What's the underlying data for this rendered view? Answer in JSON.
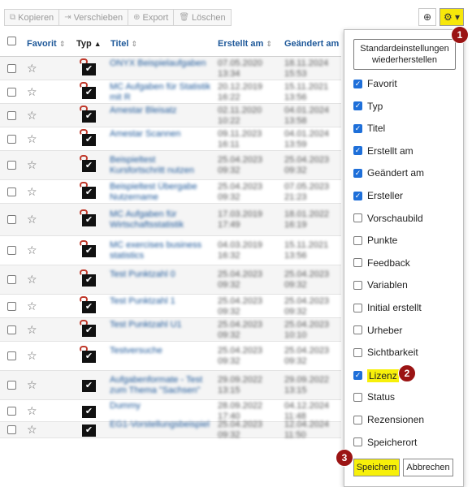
{
  "toolbar": {
    "copy_label": "Kopieren",
    "move_label": "Verschieben",
    "export_label": "Export",
    "delete_label": "Löschen"
  },
  "columns": {
    "favorit": "Favorit",
    "typ": "Typ",
    "titel": "Titel",
    "erstellt": "Erstellt am",
    "geaendert": "Geändert am"
  },
  "rows": [
    {
      "title": "ONYX Beispielaufgaben",
      "created": "07.05.2020\n13:34",
      "changed": "18.11.2024\n15:53",
      "clip": true
    },
    {
      "title": "MC Aufgaben für Statistik mit R",
      "created": "20.12.2019\n16:22",
      "changed": "15.11.2021\n13:56",
      "clip": true
    },
    {
      "title": "Amestar Bleisatz",
      "created": "02.11.2020\n10:22",
      "changed": "04.01.2024\n13:58",
      "clip": true
    },
    {
      "title": "Amestar Scannen",
      "created": "09.11.2023\n16:11",
      "changed": "04.01.2024\n13:59",
      "clip": true
    },
    {
      "title": "Beispieltest Kursfortschritt nutzen",
      "created": "25.04.2023\n09:32",
      "changed": "25.04.2023\n09:32",
      "clip": true
    },
    {
      "title": "Beispieltest Übergabe Nutzername",
      "created": "25.04.2023\n09:32",
      "changed": "07.05.2023\n21:23",
      "clip": true
    },
    {
      "title": "MC Aufgaben für Wirtschaftsstatistik",
      "created": "17.03.2019\n17:49",
      "changed": "18.01.2022\n16:19",
      "clip": true
    },
    {
      "title": "MC exercises business statistics",
      "created": "04.03.2019\n16:32",
      "changed": "15.11.2021\n13:56",
      "clip": true
    },
    {
      "title": "Test Punktzahl 0",
      "created": "25.04.2023\n09:32",
      "changed": "25.04.2023\n09:32",
      "clip": true
    },
    {
      "title": "Test Punktzahl 1",
      "created": "25.04.2023\n09:32",
      "changed": "25.04.2023\n09:32",
      "clip": true
    },
    {
      "title": "Test Punktzahl U1",
      "created": "25.04.2023\n09:32",
      "changed": "25.04.2023\n10:10",
      "clip": true
    },
    {
      "title": "Testversuche",
      "created": "25.04.2023\n09:32",
      "changed": "25.04.2023\n09:32",
      "clip": true
    },
    {
      "title": "Aufgabenformate - Test zum Thema \"Sachsen\"",
      "created": "29.09.2022\n13:15",
      "changed": "29.09.2022\n13:15",
      "clip": false
    },
    {
      "title": "Dummy",
      "created": "28.09.2022\n17:40",
      "changed": "04.12.2024\n11:48",
      "clip": false
    },
    {
      "title": "EG1-Vorstellungsbeispiel",
      "created": "25.04.2023\n09:32",
      "changed": "12.04.2024\n11:50",
      "clip": false
    }
  ],
  "panel": {
    "reset_label": "Standardeinstellungen wiederherstellen",
    "options": [
      {
        "label": "Favorit",
        "checked": true
      },
      {
        "label": "Typ",
        "checked": true
      },
      {
        "label": "Titel",
        "checked": true
      },
      {
        "label": "Erstellt am",
        "checked": true
      },
      {
        "label": "Geändert am",
        "checked": true
      },
      {
        "label": "Ersteller",
        "checked": true
      },
      {
        "label": "Vorschaubild",
        "checked": false
      },
      {
        "label": "Punkte",
        "checked": false
      },
      {
        "label": "Feedback",
        "checked": false
      },
      {
        "label": "Variablen",
        "checked": false
      },
      {
        "label": "Initial erstellt",
        "checked": false
      },
      {
        "label": "Urheber",
        "checked": false
      },
      {
        "label": "Sichtbarkeit",
        "checked": false
      },
      {
        "label": "Lizenz",
        "checked": true,
        "highlight": true
      },
      {
        "label": "Status",
        "checked": false
      },
      {
        "label": "Rezensionen",
        "checked": false
      },
      {
        "label": "Speicherort",
        "checked": false
      }
    ],
    "save_label": "Speichern",
    "cancel_label": "Abbrechen"
  },
  "markers": [
    "1",
    "2",
    "3"
  ],
  "colors": {
    "accent_yellow": "#f7f00a",
    "link_blue": "#1e5899",
    "marker_red": "#9b1414",
    "checkbox_blue": "#1e6fd9"
  }
}
